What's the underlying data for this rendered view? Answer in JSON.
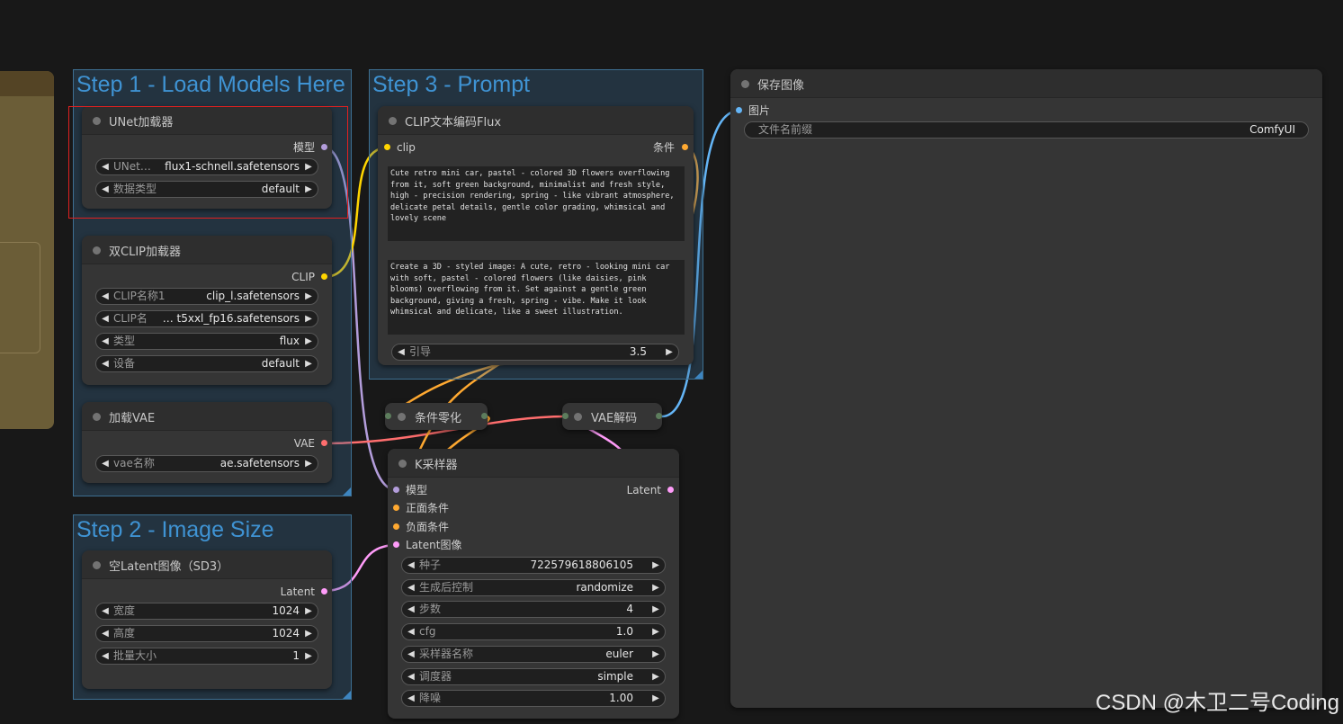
{
  "groups": {
    "step1": "Step 1 - Load Models Here",
    "step2": "Step 2 - Image Size",
    "step3": "Step 3 - Prompt"
  },
  "unet_loader": {
    "title": "UNet加载器",
    "output": "模型",
    "unet_label": "UNet…",
    "unet_value": "flux1-schnell.safetensors",
    "dtype_label": "数据类型",
    "dtype_value": "default"
  },
  "dual_clip": {
    "title": "双CLIP加载器",
    "output": "CLIP",
    "clip1_label": "CLIP名称1",
    "clip1_value": "clip_l.safetensors",
    "clip2_label": "CLIP名",
    "clip2_value": "…  t5xxl_fp16.safetensors",
    "type_label": "类型",
    "type_value": "flux",
    "device_label": "设备",
    "device_value": "default"
  },
  "vae_loader": {
    "title": "加载VAE",
    "output": "VAE",
    "vae_label": "vae名称",
    "vae_value": "ae.safetensors"
  },
  "latent_image": {
    "title": "空Latent图像（SD3）",
    "output": "Latent",
    "width_label": "宽度",
    "width_value": "1024",
    "height_label": "高度",
    "height_value": "1024",
    "batch_label": "批量大小",
    "batch_value": "1"
  },
  "clip_encode": {
    "title": "CLIP文本编码Flux",
    "input": "clip",
    "output": "条件",
    "prompt_top": "Cute retro mini car, pastel - colored 3D flowers overflowing from it, soft green background, minimalist and fresh style, high - precision rendering, spring - like vibrant atmosphere, delicate petal details, gentle color grading, whimsical and lovely scene",
    "prompt_bottom": "Create a 3D - styled image: A cute, retro - looking mini car with soft, pastel - colored flowers (like daisies, pink blooms) overflowing from it. Set against a gentle green background, giving a fresh, spring - vibe. Make it look whimsical and delicate, like a sweet illustration.",
    "guidance_label": "引导",
    "guidance_value": "3.5"
  },
  "cond_zero": {
    "title": "条件零化"
  },
  "vae_decode": {
    "title": "VAE解码"
  },
  "ksampler": {
    "title": "K采样器",
    "in_model": "模型",
    "in_positive": "正面条件",
    "in_negative": "负面条件",
    "in_latent": "Latent图像",
    "output": "Latent",
    "seed_label": "种子",
    "seed_value": "722579618806105",
    "control_label": "生成后控制",
    "control_value": "randomize",
    "steps_label": "步数",
    "steps_value": "4",
    "cfg_label": "cfg",
    "cfg_value": "1.0",
    "sampler_label": "采样器名称",
    "sampler_value": "euler",
    "scheduler_label": "调度器",
    "scheduler_value": "simple",
    "denoise_label": "降噪",
    "denoise_value": "1.00"
  },
  "save_image": {
    "title": "保存图像",
    "input": "图片",
    "prefix_label": "文件名前缀",
    "prefix_value": "ComfyUI"
  },
  "watermark": "CSDN @木卫二号Coding",
  "colors": {
    "model_pin": "#b39ddb",
    "clip_pin": "#ffd500",
    "conditioning_pin": "#ffa931",
    "vae_pin": "#ff6e6e",
    "latent_pin": "#ff9cf9",
    "image_pin": "#64b5f6",
    "highlight_box": "#e02020"
  }
}
